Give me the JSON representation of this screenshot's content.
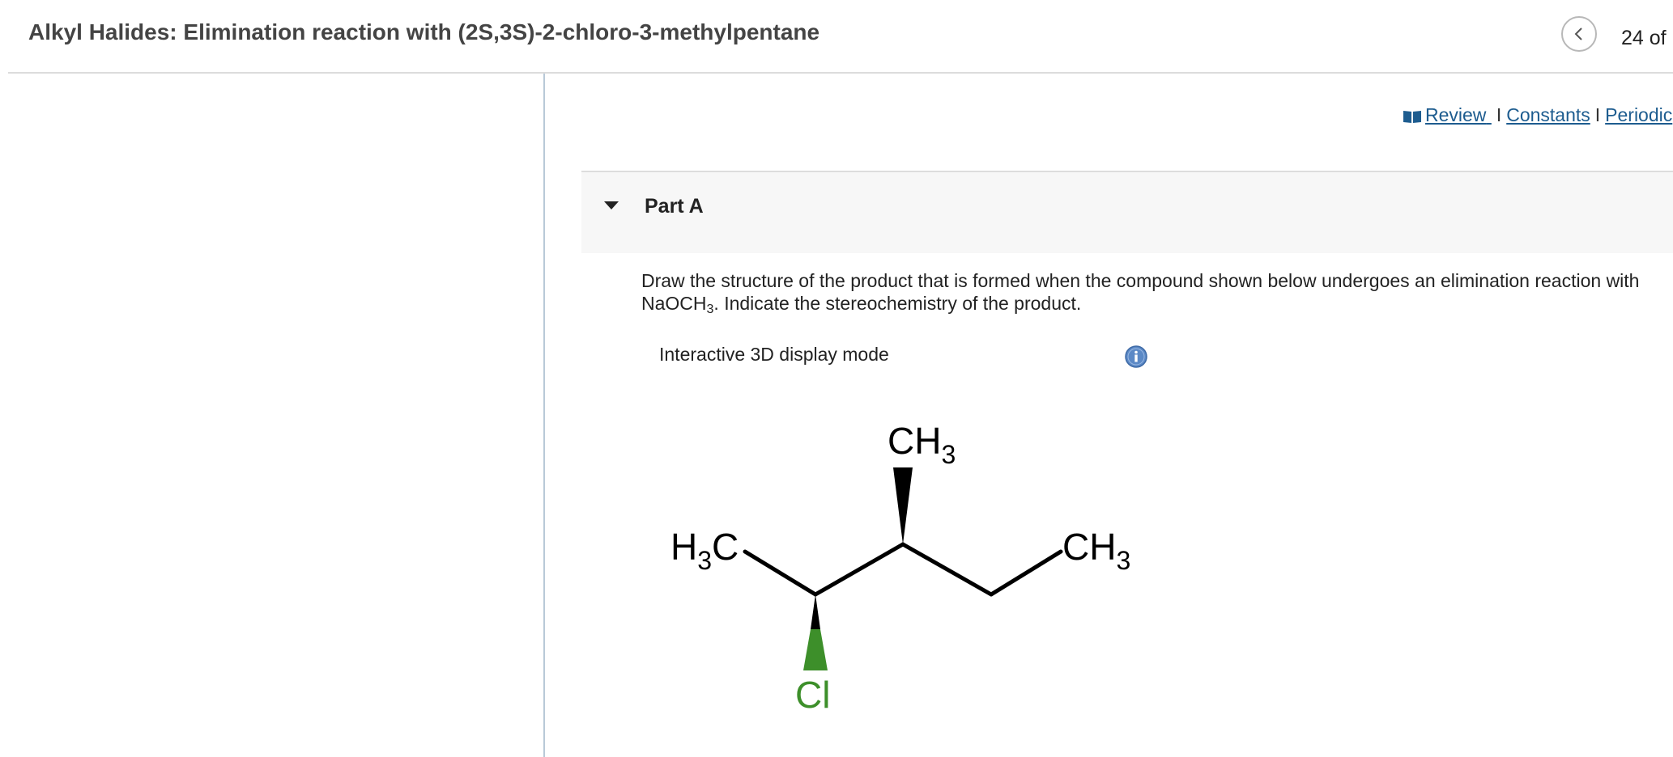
{
  "header": {
    "title": "Alkyl Halides: Elimination reaction with (2S,3S)-2-chloro-3-methylpentane",
    "page_counter": "24 of"
  },
  "resources": {
    "review": "Review",
    "constants": "Constants",
    "periodic": "Periodic",
    "separator": "I"
  },
  "part": {
    "title": "Part A"
  },
  "question": {
    "text_before": "Draw the structure of the product that is formed when the compound shown below undergoes an elimination reaction with NaOCH",
    "subscript": "3",
    "text_after": ". Indicate the stereochemistry of the product."
  },
  "display_mode": {
    "label": "Interactive 3D display mode"
  },
  "molecule": {
    "top_methyl": {
      "main": "CH",
      "sub": "3"
    },
    "left_methyl": {
      "pre": "H",
      "sub": "3",
      "post": "C"
    },
    "right_methyl": {
      "main": "CH",
      "sub": "3"
    },
    "halogen": "Cl",
    "halogen_color": "#3d8f2a",
    "bond_color": "#000000"
  },
  "colors": {
    "link": "#1d5c8f",
    "info_icon": "#5b89c6"
  }
}
